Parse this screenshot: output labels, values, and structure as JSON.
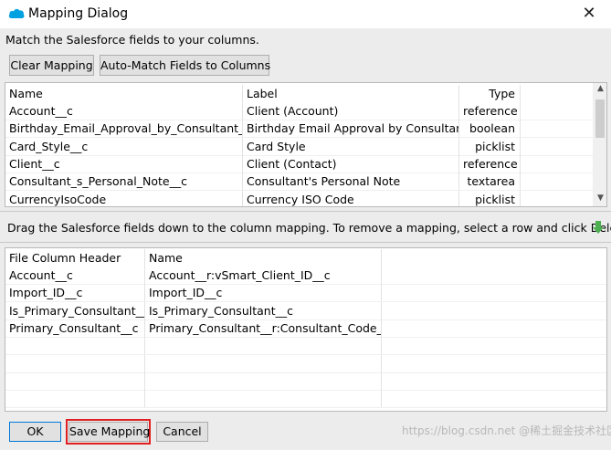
{
  "window": {
    "title": "Mapping Dialog",
    "close_glyph": "✕",
    "logo_icon": "salesforce-cloud-icon"
  },
  "instruction": "Match the Salesforce fields to your columns.",
  "toolbar": {
    "clear_label": "Clear Mapping",
    "automatch_label": "Auto-Match Fields to Columns"
  },
  "fields_table": {
    "headers": {
      "name": "Name",
      "label": "Label",
      "type": "Type"
    },
    "rows": [
      {
        "name": "Account__c",
        "label": "Client (Account)",
        "type": "reference"
      },
      {
        "name": "Birthday_Email_Approval_by_Consultant__c",
        "label": "Birthday Email Approval by Consultant",
        "type": "boolean"
      },
      {
        "name": "Card_Style__c",
        "label": "Card Style",
        "type": "picklist"
      },
      {
        "name": "Client__c",
        "label": "Client (Contact)",
        "type": "reference"
      },
      {
        "name": "Consultant_s_Personal_Note__c",
        "label": "Consultant's Personal Note",
        "type": "textarea"
      },
      {
        "name": "CurrencyIsoCode",
        "label": "Currency ISO Code",
        "type": "picklist"
      }
    ]
  },
  "drag_hint": "Drag the Salesforce fields down to the column mapping.  To remove a mapping, select a row and click Delete.",
  "drag_icon": "down-arrow-icon",
  "mapping_table": {
    "headers": {
      "file_column": "File Column Header",
      "name": "Name"
    },
    "rows": [
      {
        "file_column": "Account__c",
        "name": "Account__r:vSmart_Client_ID__c"
      },
      {
        "file_column": "Import_ID__c",
        "name": "Import_ID__c"
      },
      {
        "file_column": "Is_Primary_Consultant__c",
        "name": "Is_Primary_Consultant__c"
      },
      {
        "file_column": "Primary_Consultant__c",
        "name": "Primary_Consultant__r:Consultant_Code__c"
      }
    ]
  },
  "footer": {
    "ok_label": "OK",
    "save_label": "Save Mapping",
    "cancel_label": "Cancel"
  },
  "watermark": "https://blog.csdn.net @稀土掘金技术社区",
  "colors": {
    "accent": "#0078d7",
    "highlight_border": "#e02020",
    "salesforce_blue": "#00a1e0",
    "drag_arrow": "#4caf50"
  }
}
